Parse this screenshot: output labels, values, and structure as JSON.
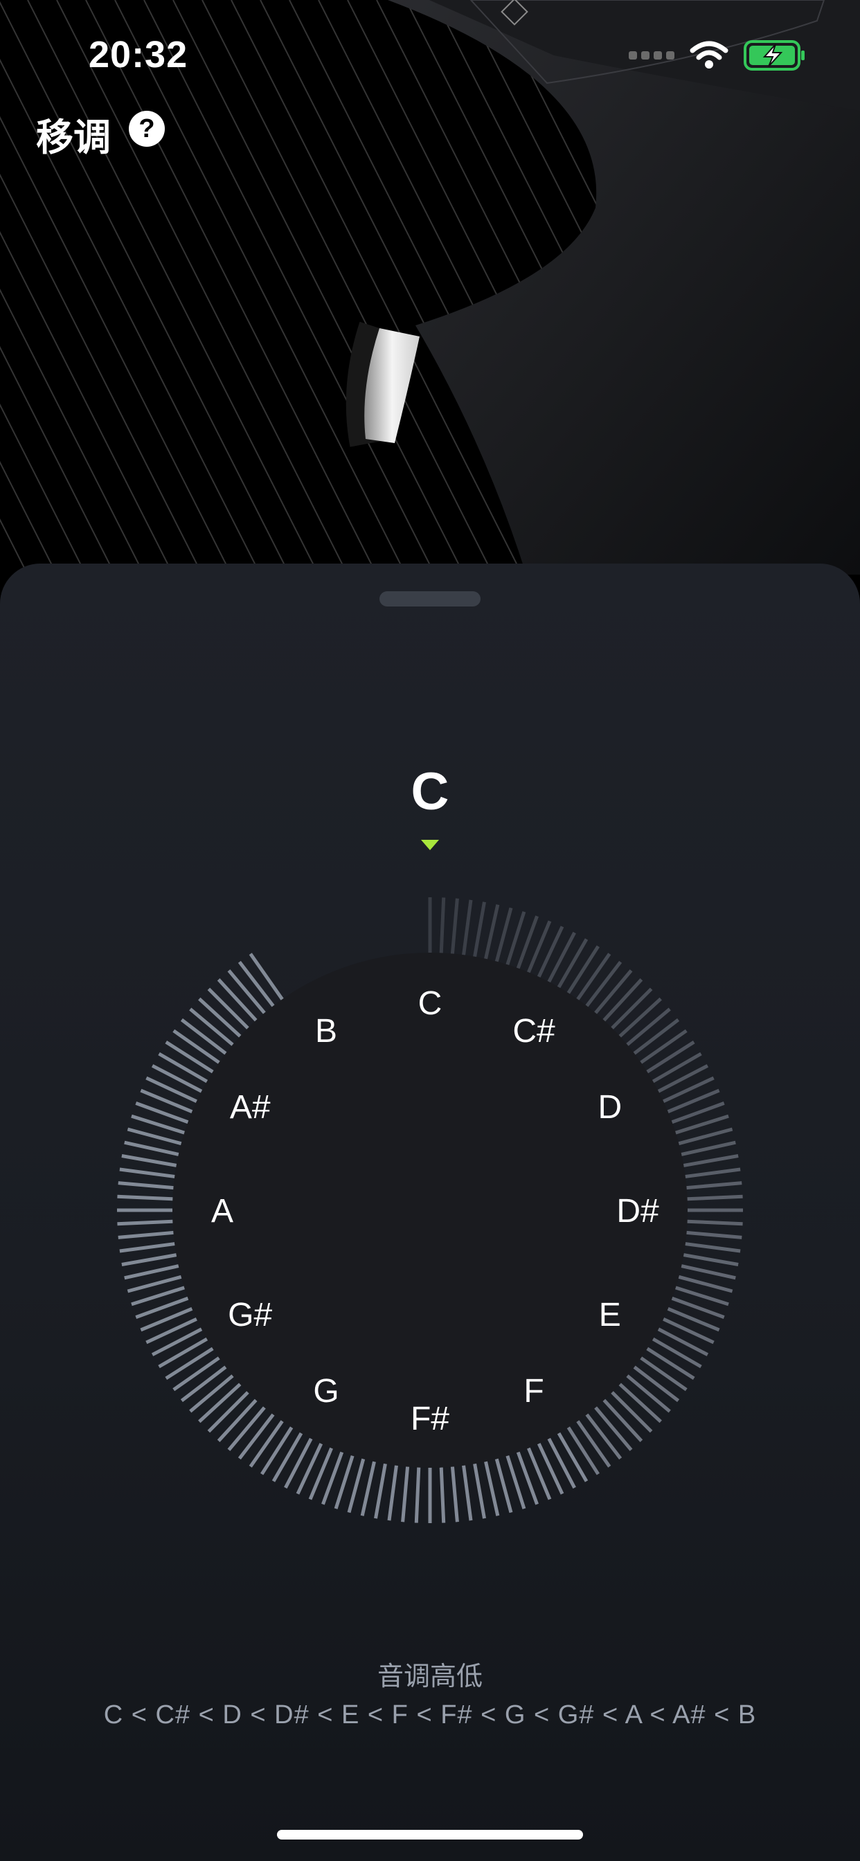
{
  "status_bar": {
    "time": "20:32",
    "icons": [
      "cellular-signal-icon",
      "wifi-icon",
      "battery-charging-icon"
    ],
    "battery_color": "#34c759"
  },
  "header": {
    "title": "移调",
    "help_label": "?"
  },
  "key_dial": {
    "current_key": "C",
    "pointer_color": "#a8e63c",
    "notes": [
      "C",
      "C#",
      "D",
      "D#",
      "E",
      "F",
      "F#",
      "G",
      "G#",
      "A",
      "A#",
      "B"
    ],
    "selected_note": "C"
  },
  "pitch_info": {
    "title": "音调高低",
    "order": "C < C# < D < D# < E < F < F# < G < G# < A < A# < B"
  }
}
